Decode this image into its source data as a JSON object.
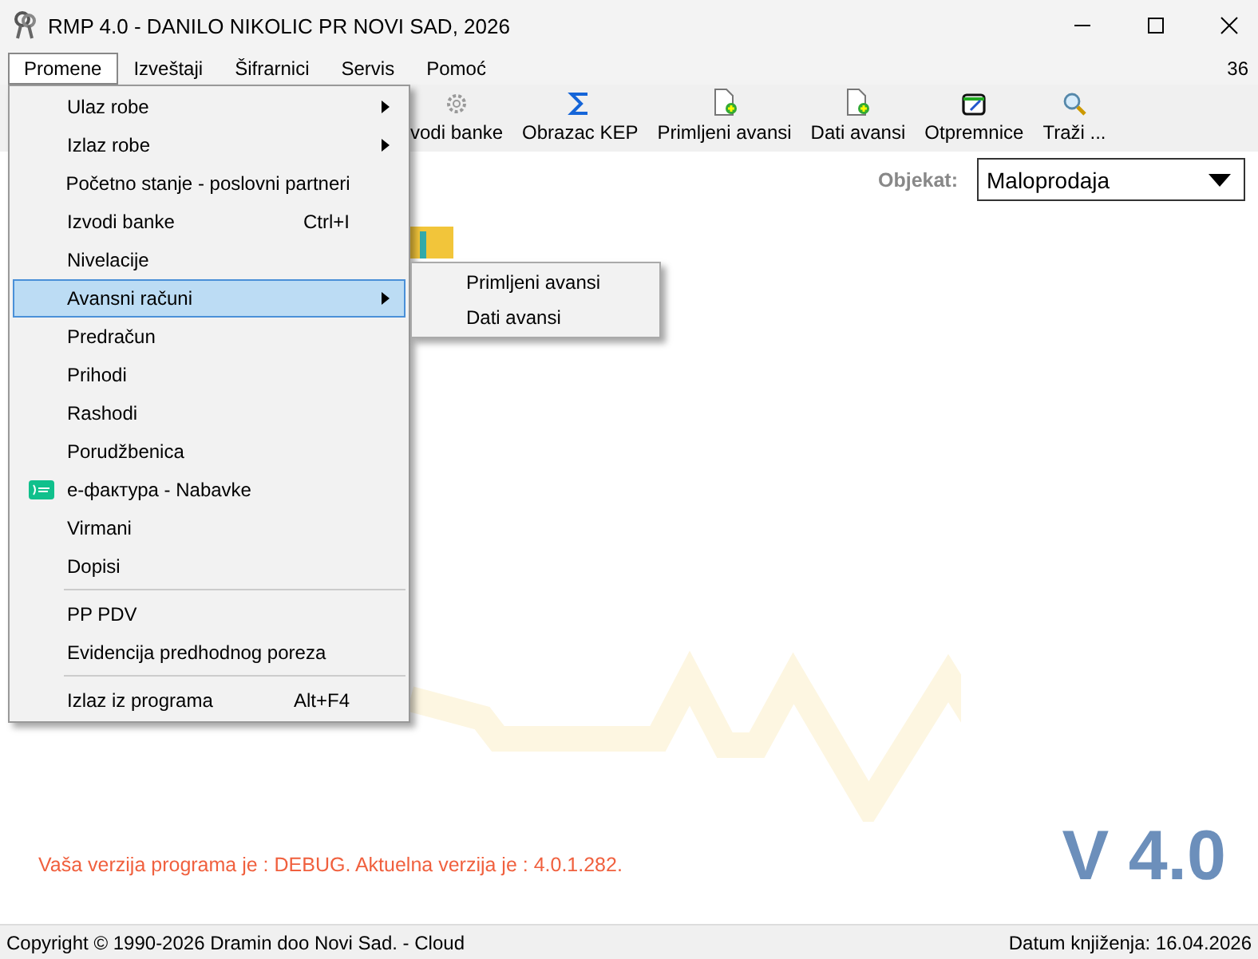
{
  "window": {
    "title": "RMP 4.0 - DANILO NIKOLIC PR NOVI SAD, 2026"
  },
  "menubar": {
    "items": [
      {
        "label": "Promene",
        "selected": true
      },
      {
        "label": "Izveštaji",
        "selected": false
      },
      {
        "label": "Šifrarnici",
        "selected": false
      },
      {
        "label": "Servis",
        "selected": false
      },
      {
        "label": "Pomoć",
        "selected": false
      }
    ],
    "counter": "36"
  },
  "toolbar": [
    {
      "label": "vodi banke",
      "kind": "gear"
    },
    {
      "label": "Obrazac KEP",
      "kind": "sigma"
    },
    {
      "label": "Primljeni avansi",
      "kind": "document"
    },
    {
      "label": "Dati avansi",
      "kind": "document"
    },
    {
      "label": "Otpremnice",
      "kind": "notepad"
    },
    {
      "label": "Traži ...",
      "kind": "search"
    }
  ],
  "objekat": {
    "label": "Objekat:",
    "value": "Maloprodaja"
  },
  "menu": [
    {
      "kind": "item",
      "label": "Ulaz robe",
      "submenu": true,
      "selected": false
    },
    {
      "kind": "item",
      "label": "Izlaz robe",
      "submenu": true,
      "selected": false
    },
    {
      "kind": "item",
      "label": "Početno stanje - poslovni partneri",
      "selected": false
    },
    {
      "kind": "item",
      "label": "Izvodi banke",
      "shortcut": "Ctrl+I",
      "selected": false
    },
    {
      "kind": "item",
      "label": "Nivelacije",
      "selected": false
    },
    {
      "kind": "item",
      "label": "Avansni računi",
      "submenu": true,
      "selected": true
    },
    {
      "kind": "item",
      "label": "Predračun",
      "selected": false
    },
    {
      "kind": "item",
      "label": "Prihodi",
      "selected": false
    },
    {
      "kind": "item",
      "label": "Rashodi",
      "selected": false
    },
    {
      "kind": "item",
      "label": "Porudžbenica",
      "selected": false
    },
    {
      "kind": "icon_item",
      "label": "е-фактура - Nabavke",
      "selected": false
    },
    {
      "kind": "item",
      "label": "Virmani",
      "selected": false
    },
    {
      "kind": "item",
      "label": "Dopisi",
      "selected": false
    },
    {
      "kind": "separator"
    },
    {
      "kind": "item",
      "label": "PP PDV",
      "selected": false
    },
    {
      "kind": "item",
      "label": "Evidencija predhodnog poreza",
      "selected": false
    },
    {
      "kind": "separator"
    },
    {
      "kind": "item",
      "label": "Izlaz iz programa",
      "shortcut": "Alt+F4",
      "selected": false
    }
  ],
  "submenu": [
    {
      "label": "Primljeni avansi",
      "selected": false
    },
    {
      "label": "Dati avansi",
      "selected": false
    }
  ],
  "version_message": "Vaša verzija programa je : DEBUG. Aktuelna verzija je : 4.0.1.282.",
  "version_badge": "V 4.0",
  "status_bar": {
    "copyright": "Copyright © 1990-2026 Dramin doo Novi Sad. - Cloud",
    "date": "Datum knjiženja: 16.04.2026"
  }
}
